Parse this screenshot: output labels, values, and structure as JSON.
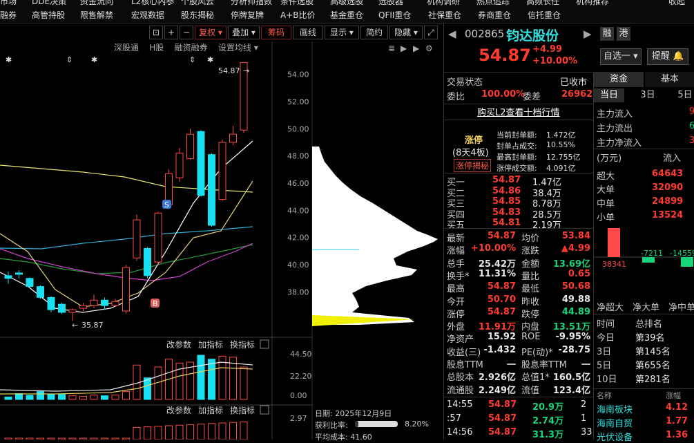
{
  "menu": {
    "row1": [
      "市场",
      "DDE决策",
      "资金流向",
      "L2核心內参",
      "个股风云",
      "分析师指数",
      "条件选股",
      "高级选股",
      "选股器",
      "机构调研",
      "热点追踪",
      "高频长任",
      "机构推荐",
      "收起"
    ],
    "row2": [
      "融券",
      "高管持股",
      "限售解禁",
      "宏观数据",
      "股东揭秘",
      "停牌复牌",
      "A+B比价",
      "基金重仓",
      "QFII重仓",
      "社保重仓",
      "券商重仓",
      "信托重仓"
    ]
  },
  "toolbar": {
    "buttons": [
      "复权",
      "叠加",
      "筹码",
      "画线",
      "显示",
      "简约",
      "隐藏"
    ],
    "sub": [
      "深股通",
      "H股",
      "融资融券",
      "设置均线"
    ]
  },
  "chart": {
    "price_axis": [
      "54.00",
      "52.00",
      "50.00",
      "48.00",
      "46.00",
      "44.00",
      "42.00",
      "40.00",
      "38.00"
    ],
    "high_label": "54.87",
    "low_label": "35.87",
    "sub1_axis": [
      "44.50",
      "22.20",
      "0.00"
    ],
    "sub2_axis": [
      "2.97"
    ],
    "sub_buttons": [
      "改参数",
      "加指标",
      "换指标"
    ],
    "info_date": "日期: 2025年12月9日",
    "info_profit_label": "获利比率:",
    "info_profit": "8.20%",
    "info_avg": "平均成本: 41.60",
    "marker_s": "S",
    "marker_b": "B"
  },
  "chart_data": {
    "type": "candlestick",
    "title": "",
    "ylim": [
      36.5,
      55.5
    ],
    "candles": [
      {
        "o": 39.2,
        "c": 39.0,
        "h": 39.5,
        "l": 38.6
      },
      {
        "o": 39.4,
        "c": 39.3,
        "h": 39.6,
        "l": 39.0
      },
      {
        "o": 39.0,
        "c": 38.4,
        "h": 39.1,
        "l": 38.3
      },
      {
        "o": 38.4,
        "c": 37.6,
        "h": 38.5,
        "l": 37.5
      },
      {
        "o": 37.6,
        "c": 36.7,
        "h": 37.7,
        "l": 36.5
      },
      {
        "o": 37.1,
        "c": 36.5,
        "h": 37.2,
        "l": 36.4
      },
      {
        "o": 36.5,
        "c": 36.7,
        "h": 36.8,
        "l": 35.87
      },
      {
        "o": 36.8,
        "c": 37.0,
        "h": 37.2,
        "l": 36.6
      },
      {
        "o": 37.0,
        "c": 37.4,
        "h": 37.8,
        "l": 36.8
      },
      {
        "o": 37.4,
        "c": 37.0,
        "h": 37.6,
        "l": 36.7
      },
      {
        "o": 37.0,
        "c": 37.3,
        "h": 37.5,
        "l": 36.9
      },
      {
        "o": 36.6,
        "c": 39.8,
        "h": 40.0,
        "l": 36.4
      },
      {
        "o": 40.5,
        "c": 43.3,
        "h": 43.7,
        "l": 40.3
      },
      {
        "o": 41.2,
        "c": 39.2,
        "h": 41.3,
        "l": 39.0
      },
      {
        "o": 40.2,
        "c": 43.8,
        "h": 43.9,
        "l": 40.0
      },
      {
        "o": 44.4,
        "c": 46.7,
        "h": 47.0,
        "l": 44.2
      },
      {
        "o": 46.4,
        "c": 48.2,
        "h": 48.6,
        "l": 46.1
      },
      {
        "o": 47.8,
        "c": 49.6,
        "h": 50.0,
        "l": 47.7
      },
      {
        "o": 49.8,
        "c": 45.1,
        "h": 49.9,
        "l": 45.0
      },
      {
        "o": 48.1,
        "c": 42.9,
        "h": 48.2,
        "l": 42.8
      },
      {
        "o": 44.8,
        "c": 49.0,
        "h": 49.2,
        "l": 44.7
      },
      {
        "o": 49.0,
        "c": 49.6,
        "h": 50.2,
        "l": 48.8
      },
      {
        "o": 49.9,
        "c": 54.87,
        "h": 54.87,
        "l": 49.7
      }
    ],
    "volumes": [
      2.5,
      6.0,
      4.2,
      8.5,
      5.0,
      5.5,
      4.0,
      3.2,
      4.5,
      3.8,
      4.5,
      8.0,
      35.0,
      22.0,
      33.0,
      41.0,
      37.0,
      38.0,
      45.0,
      41.0,
      44.0,
      43.0,
      33.0
    ]
  },
  "stock": {
    "code": "002865",
    "name": "钧达股份",
    "price": "54.87",
    "change": "+4.99",
    "pct": "+10.00%",
    "tag1": "融",
    "tag2": "港",
    "btn_self": "自选一",
    "btn_remind": "提醒"
  },
  "quote": {
    "status_label": "交易状态",
    "status": "已收市",
    "wb_label": "委比",
    "wb": "100.00%",
    "wc_label": "委差",
    "wc": "26962",
    "l2": "购买L2查看十档行情",
    "limit_tag": "涨停",
    "limit_sub": "(8天4板)",
    "limit_secret": "涨停揭秘",
    "seal": [
      [
        "当前封单额:",
        "1.472亿"
      ],
      [
        "封单占成交:",
        "10.55%"
      ],
      [
        "最高封单额:",
        "12.755亿"
      ],
      [
        "涨停成交额:",
        "4.091亿"
      ]
    ],
    "bids": [
      [
        "买一",
        "54.87",
        "1.47亿"
      ],
      [
        "买二",
        "54.86",
        "38.4万"
      ],
      [
        "买三",
        "54.85",
        "8.78万"
      ],
      [
        "买四",
        "54.83",
        "28.5万"
      ],
      [
        "买五",
        "54.81",
        "2.19万"
      ]
    ],
    "stats": [
      [
        "最新",
        "54.87",
        "均价",
        "53.84"
      ],
      [
        "涨幅",
        "+10.00%",
        "涨跌",
        "▲4.99"
      ],
      [
        "总手",
        "25.42万",
        "金额",
        "13.69亿"
      ],
      [
        "换手*",
        "11.31%",
        "量比",
        "0.65"
      ],
      [
        "最高",
        "54.87",
        "最低",
        "50.68"
      ],
      [
        "今开",
        "50.70",
        "昨收",
        "49.88"
      ],
      [
        "涨停",
        "54.87",
        "跌停",
        "44.89"
      ],
      [
        "外盘",
        "11.91万",
        "内盘",
        "13.51万"
      ],
      [
        "净资产",
        "15.92",
        "ROE",
        "-9.95%"
      ],
      [
        "收益(三)",
        "-1.432",
        "PE(动)*",
        "-28.75"
      ],
      [
        "股息TTM",
        "一",
        "股息率TTM",
        "一"
      ],
      [
        "总股本",
        "2.926亿",
        "总值1*",
        "160.5亿"
      ],
      [
        "流通股",
        "2.249亿",
        "流值",
        "123.4亿"
      ]
    ],
    "ticks": [
      [
        "14:55",
        "54.87",
        "20.9万",
        "2"
      ],
      [
        ":57",
        "54.87",
        "2.74万",
        "1"
      ],
      [
        "14:56",
        "54.87",
        "31.3万",
        "33"
      ]
    ]
  },
  "fund": {
    "tabs": [
      "资金",
      "基本"
    ],
    "periods": [
      "当日",
      "3日",
      "5日"
    ],
    "flows": [
      [
        "主力流入",
        "9"
      ],
      [
        "主力流出",
        "6"
      ],
      [
        "主力净流入",
        "3"
      ]
    ],
    "unit": "(万元)",
    "in_label": "流入",
    "sizes": [
      [
        "超大",
        "64643"
      ],
      [
        "大单",
        "32090"
      ],
      [
        "中单",
        "24899"
      ],
      [
        "小单",
        "13524"
      ]
    ],
    "bars": [
      "38341",
      "-7211",
      "-14559"
    ],
    "bar_labels": [
      "净超大",
      "净大单",
      "净中单"
    ],
    "rank_head": [
      "时间",
      "总排名"
    ],
    "ranks": [
      [
        "今日",
        "第39名"
      ],
      [
        "3日",
        "第145名"
      ],
      [
        "5日",
        "第655名"
      ],
      [
        "10日",
        "第281名"
      ]
    ],
    "sector_head": [
      "名称",
      "涨幅"
    ],
    "sectors": [
      [
        "海南板块",
        "4.12"
      ],
      [
        "海南自贸",
        "1.77"
      ],
      [
        "光伏设备",
        "1.36"
      ]
    ]
  }
}
